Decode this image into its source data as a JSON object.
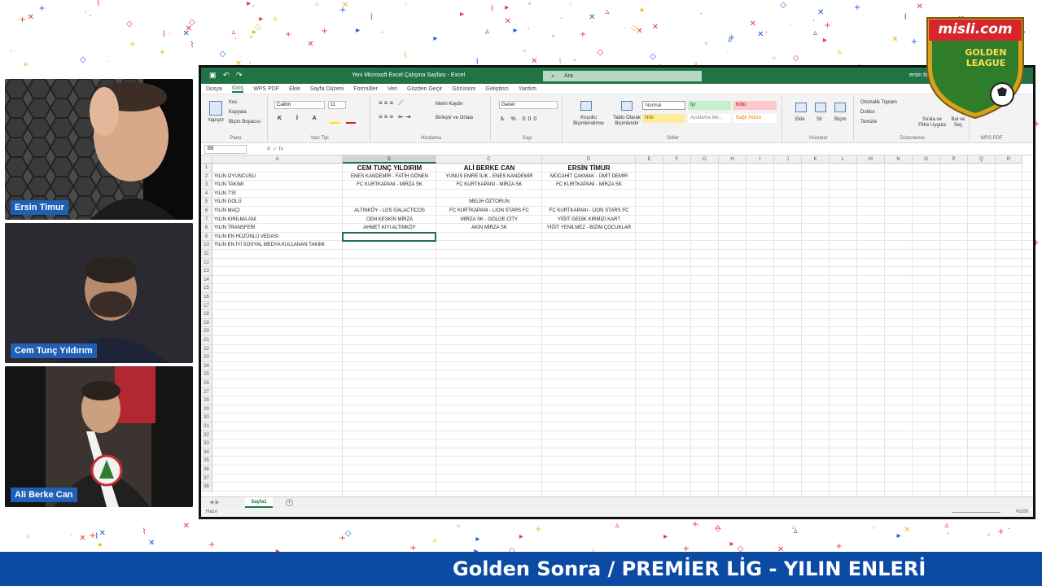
{
  "show_title": "Golden Sonra / PREMİER LİG - YILIN ENLERİ",
  "brand": {
    "logo_text": "misli.com",
    "logo_sub": "GOLDEN LEAGUE",
    "colors": {
      "green": "#2f7d2a",
      "gold": "#d9a21c",
      "red": "#d6262b",
      "blue_bar": "#0c4ba4"
    }
  },
  "participants": [
    {
      "name": "Ersin Timur"
    },
    {
      "name": "Cem Tunç Yıldırım"
    },
    {
      "name": "Ali Berke Can"
    }
  ],
  "excel": {
    "window_title": "Yeni Microsoft Excel Çalışma Sayfası - Excel",
    "search_placeholder": "Ara",
    "user_name": "ersin tim",
    "menu": [
      "Dosya",
      "Giriş",
      "WPS PDF",
      "Ekle",
      "Sayfa Düzeni",
      "Formüller",
      "Veri",
      "Gözden Geçir",
      "Görünüm",
      "Geliştirici",
      "Yardım"
    ],
    "active_menu": "Giriş",
    "ribbon": {
      "cut": "Kes",
      "copy": "Kopyala",
      "format_painter": "Biçim Boyacısı",
      "paste": "Yapıştır",
      "font": "Calibri",
      "font_size": "11",
      "wrap_text": "Metni Kaydır",
      "merge_center": "Birleştir ve Ortala",
      "number_format": "Genel",
      "conditional": "Koşullu Biçimlendirme",
      "format_table": "Tablo Olarak Biçimlendir",
      "style_normal": "Normal",
      "style_good": "İyi",
      "style_bad": "Kötü",
      "style_neutral": "Nötr",
      "style_explanatory": "Açıklama Me...",
      "style_linked": "Bağlı Hücre",
      "insert": "Ekle",
      "delete": "Sil",
      "format": "Biçim",
      "autosum": "Otomatik Toplam",
      "fill": "Doldur",
      "clear": "Temizle",
      "sort_filter": "Sırala ve Filtre Uygula",
      "find_select": "Bul ve Seç",
      "groups": [
        "Pano",
        "Yazı Tipi",
        "Hizalama",
        "Sayı",
        "Stiller",
        "Hücreler",
        "Düzenleme",
        "WPS PDF"
      ]
    },
    "name_box": "B9",
    "columns": [
      "A",
      "B",
      "C",
      "D",
      "E",
      "F",
      "G",
      "H",
      "I",
      "J",
      "K",
      "L",
      "M",
      "N",
      "O",
      "P",
      "Q",
      "R"
    ],
    "selected_column": "B",
    "headers": [
      "CEM TUNÇ YILDIRIM",
      "ALİ BERKE CAN",
      "ERSİN TİMUR"
    ],
    "rows": [
      {
        "a": "YILIN OYUNCUSU",
        "b": "ENES KANDEMİR - FATİH GÖNEN",
        "c": "YUNUS EMRE İLİK - ENES KANDEMİR",
        "d": "MÜCAHİT ÇAKMAK - ÜMİT DEMİR"
      },
      {
        "a": "YILIN TAKIMI",
        "b": "FC KURTKAPANI - MİRZA SK",
        "c": "FC KURTKAPANI - MİRZA SK",
        "d": "FC KURTKAPANI - MİRZA SK"
      },
      {
        "a": "YILIN 7'Sİ",
        "b": "",
        "c": "",
        "d": ""
      },
      {
        "a": "YILIN GOLÜ",
        "b": "",
        "c": "MELİH ÖZTORUN",
        "d": ""
      },
      {
        "a": "YILIN MAÇI",
        "b": "ALTINKÖY - LOS GALACTICOS",
        "c": "FC KURTKAPANI - LION STARS FC",
        "d": "FC KURTKAPANI - LION STARS FC"
      },
      {
        "a": "YILIN KIRILMA ANI",
        "b": "CEM KESKİN MİRZA",
        "c": "MİRZA SK - GÖLGE CİTY",
        "d": "YİĞİT GEDİK KIRMIZI KART"
      },
      {
        "a": "YILIN TRANSFERİ",
        "b": "AHMET KIYI ALTINKÖY",
        "c": "AKIN MİRZA SK",
        "d": "YİĞİT YENİLMEZ - BİZİM ÇOCUKLAR"
      },
      {
        "a": "YILIN EN HÜZÜNLÜ VEDASI",
        "b": "",
        "c": "",
        "d": ""
      },
      {
        "a": "YILIN EN İYİ SOSYAL MEDYA KULLANAN TAKIMI",
        "b": "",
        "c": "",
        "d": ""
      }
    ],
    "sheet_tab": "Sayfa1",
    "status_ready": "Hazır",
    "zoom": "%100"
  }
}
